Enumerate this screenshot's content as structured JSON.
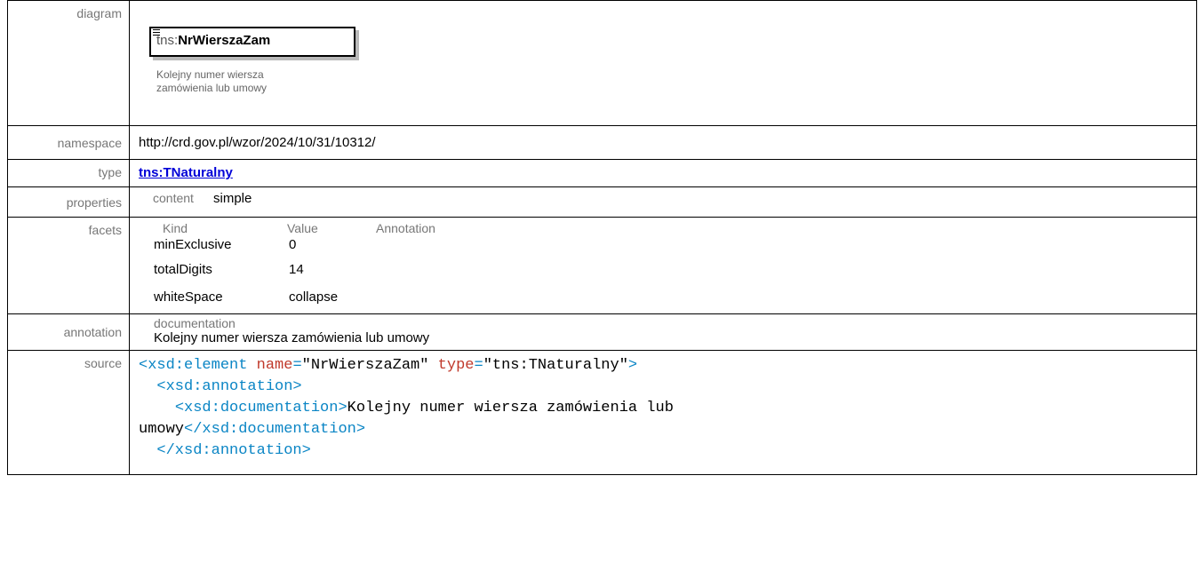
{
  "rows": {
    "diagram": {
      "label": "diagram",
      "element_prefix": "tns:",
      "element_name": "NrWierszaZam",
      "doc_line1": "Kolejny numer wiersza",
      "doc_line2": "zamówienia lub umowy"
    },
    "namespace": {
      "label": "namespace",
      "value": "http://crd.gov.pl/wzor/2024/10/31/10312/"
    },
    "type": {
      "label": "type",
      "value": "tns:TNaturalny"
    },
    "properties": {
      "label": "properties",
      "key": "content",
      "value": "simple"
    },
    "facets": {
      "label": "facets",
      "headers": [
        "Kind",
        "Value",
        "Annotation"
      ],
      "items": [
        {
          "kind": "minExclusive",
          "value": "0"
        },
        {
          "kind": "totalDigits",
          "value": "14"
        },
        {
          "kind": "whiteSpace",
          "value": "collapse"
        }
      ]
    },
    "annotation": {
      "label": "annotation",
      "key": "documentation",
      "value": "Kolejny numer wiersza zamówienia lub umowy"
    },
    "source": {
      "label": "source",
      "l1_open": "<xsd:element",
      "l1_attr1": "name",
      "l1_val1": "\"NrWierszaZam\"",
      "l1_attr2": "type",
      "l1_val2": "\"tns:TNaturalny\"",
      "l1_close": ">",
      "l2": "<xsd:annotation>",
      "l3_open": "<xsd:documentation>",
      "l3_text": "Kolejny numer wiersza zamówienia lub",
      "l4_text": "umowy",
      "l4_close": "</xsd:documentation>",
      "l5": "</xsd:annotation>"
    }
  }
}
